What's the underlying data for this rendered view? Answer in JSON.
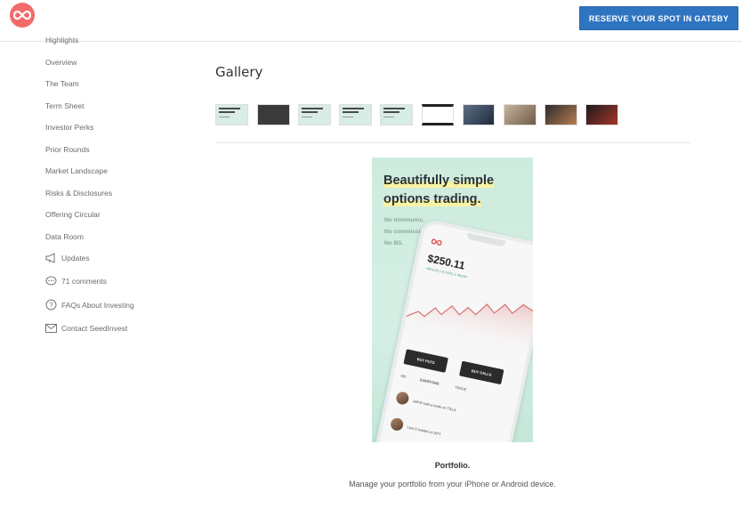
{
  "header": {
    "logo_icon": "infinity-logo-icon",
    "reserve_button": "RESERVE YOUR SPOT IN GATSBY",
    "brand_color": "#f26a6a",
    "button_color": "#2f74c0"
  },
  "sidebar": {
    "items": [
      {
        "label": "Highlights"
      },
      {
        "label": "Overview"
      },
      {
        "label": "The Team"
      },
      {
        "label": "Term Sheet"
      },
      {
        "label": "Investor Perks"
      },
      {
        "label": "Prior Rounds"
      },
      {
        "label": "Market Landscape"
      },
      {
        "label": "Risks & Disclosures"
      },
      {
        "label": "Offering Circular"
      },
      {
        "label": "Data Room"
      }
    ],
    "icon_items": [
      {
        "label": "Updates",
        "icon": "megaphone-icon"
      },
      {
        "label": "71 comments",
        "icon": "comment-bubble-icon"
      },
      {
        "label": "FAQs About Investing",
        "icon": "question-circle-icon"
      },
      {
        "label": "Contact SeedInvest",
        "icon": "envelope-icon"
      }
    ]
  },
  "gallery": {
    "title": "Gallery",
    "thumbnails_count": 10,
    "selected_image": {
      "headline_line1": "Beautifully simple",
      "headline_line2": "options trading.",
      "sub_lines": [
        "No minimums.",
        "No commission.",
        "No BS."
      ],
      "phone": {
        "price": "$250.11",
        "change": "+$24.09 (+9.54%) 1 Month",
        "buy_puts": "BUY PUTS",
        "buy_calls": "BUY CALLS",
        "tabs": [
          "ME",
          "EVERYONE",
          "TRADE"
        ],
        "feed": [
          "Jeff M sold a trade on TSLA",
          "Lisa G traded on SPY"
        ]
      }
    },
    "caption_title": "Portfolio.",
    "caption_text": "Manage your portfolio from your iPhone or Android device."
  }
}
